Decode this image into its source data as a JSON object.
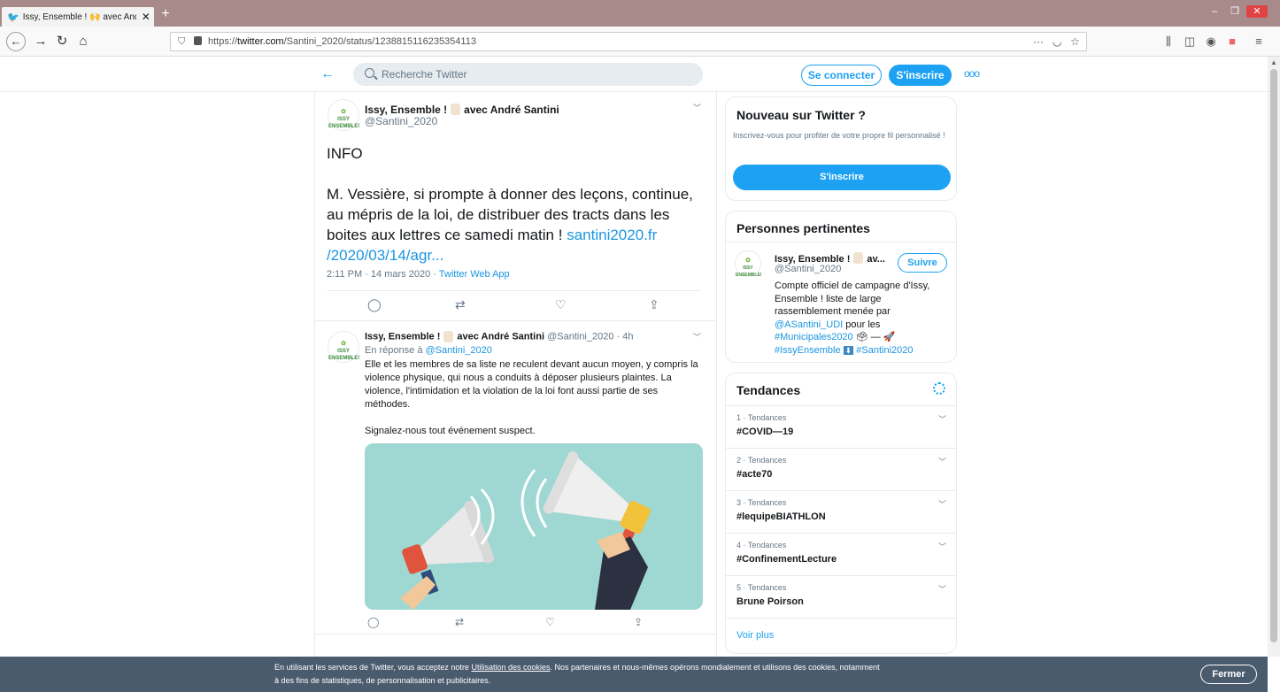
{
  "browser": {
    "tab_title": "Issy, Ensemble ! 🙌 avec André",
    "tab_close": "✕",
    "new_tab": "+",
    "url_prefix": "https://",
    "url_domain": "twitter.com",
    "url_path": "/Santini_2020/status/1238815116235354113",
    "page_actions": "···"
  },
  "twitter_header": {
    "search_placeholder": "Recherche Twitter",
    "login_label": "Se connecter",
    "signup_label": "S'inscrire",
    "more_label": "ooo"
  },
  "main_tweet": {
    "avatar_text": "ISSY ENSEMBLE!",
    "author_name": "Issy, Ensemble !",
    "author_name_suffix": "avec André Santini",
    "handle": "@Santini_2020",
    "body_line1": "INFO",
    "body_line2": "M. Vessière, si prompte à donner des leçons, continue,",
    "body_line3": "au mépris de la loi, de distribuer des tracts dans les",
    "body_line4": "boites aux lettres ce samedi matin !",
    "body_link_part1": "santini2020.fr",
    "body_link_part2": "/2020/03/14/agr...",
    "meta_time": "2:11 PM · 14 mars 2020 · ",
    "meta_source": "Twitter Web App"
  },
  "reply_tweet": {
    "author_name": "Issy, Ensemble !",
    "author_name_suffix": "avec André Santini",
    "handle_time": "@Santini_2020 · 4h",
    "reply_to_prefix": "En réponse à ",
    "reply_to_handle": "@Santini_2020",
    "text_line1": "Elle et les membres de sa liste ne reculent devant aucun moyen, y compris la",
    "text_line2": "violence physique, qui nous a conduits à déposer plusieurs plaintes. La",
    "text_line3": "violence, l'intimidation et la violation de la loi font aussi partie de ses",
    "text_line4": "méthodes.",
    "text_line5": "Signalez-nous tout événement suspect."
  },
  "sidebar": {
    "new_title": "Nouveau sur Twitter ?",
    "new_desc": "Inscrivez-vous pour profiter de votre propre fil personnalisé !",
    "new_button": "S'inscrire",
    "people_title": "Personnes pertinentes",
    "person_name": "Issy, Ensemble !",
    "person_name_suffix": "av...",
    "person_handle": "@Santini_2020",
    "follow_label": "Suivre",
    "bio_line1": "Compte officiel de campagne d'Issy,",
    "bio_line2": "Ensemble ! liste de large",
    "bio_line3": "rassemblement menée par",
    "bio_mention": "@ASantini_UDI",
    "bio_line4_suffix": " pour les",
    "bio_hashtag1": "#Municipales2020",
    "bio_emoji1": "🗳 — 🚀",
    "bio_hashtag2": "#IssyEnsemble",
    "bio_emoji2": "⬇",
    "bio_hashtag3": "#Santini2020",
    "trends_title": "Tendances",
    "trends": [
      {
        "category": "1 · Tendances",
        "tag": "#COVID—19"
      },
      {
        "category": "2 · Tendances",
        "tag": "#acte70"
      },
      {
        "category": "3 · Tendances",
        "tag": "#lequipeBIATHLON"
      },
      {
        "category": "4 · Tendances",
        "tag": "#ConfinementLecture"
      },
      {
        "category": "5 · Tendances",
        "tag": "Brune Poirson"
      }
    ],
    "see_more": "Voir plus"
  },
  "cookie_banner": {
    "text_before": "En utilisant les services de Twitter, vous acceptez notre ",
    "link_label": "Utilisation des cookies",
    "text_after": ". Nos partenaires et nous-mêmes opérons mondialement et utilisons des cookies, notamment",
    "text_line2": "à des fins de statistiques, de personnalisation et publicitaires.",
    "close_label": "Fermer"
  }
}
